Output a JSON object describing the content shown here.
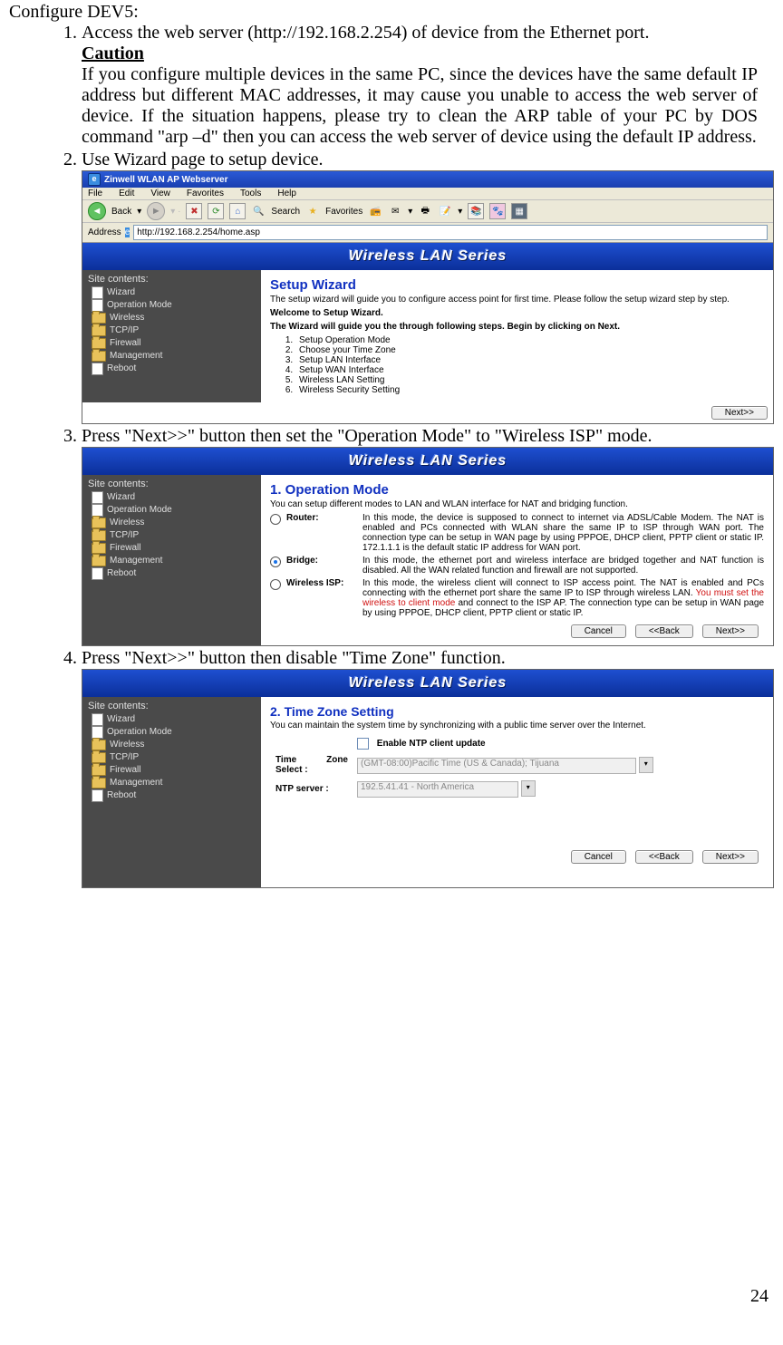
{
  "intro": "Configure DEV5:",
  "step1": "Access the web server (http://192.168.2.254) of device from the Ethernet port.",
  "caution_title": "Caution",
  "caution_body": "If you configure multiple devices in the same PC, since the devices have the same default IP address but different MAC addresses, it may cause you unable to access the web server of device. If the situation happens, please try to clean the ARP table of your PC by DOS command \"arp –d\" then you can access the web server of device using the default IP address.",
  "step2": "Use Wizard page to setup device.",
  "step3": "Press \"Next>>\" button then set the  \"Operation Mode\" to \"Wireless ISP\" mode.",
  "step4": "Press \"Next>>\" button then disable \"Time Zone\" function.",
  "page_number": "24",
  "ie": {
    "title": "Zinwell WLAN AP Webserver",
    "menu": {
      "file": "File",
      "edit": "Edit",
      "view": "View",
      "favorites": "Favorites",
      "tools": "Tools",
      "help": "Help"
    },
    "toolbar": {
      "back": "Back",
      "search": "Search",
      "favorites": "Favorites"
    },
    "address_label": "Address",
    "address_value": "http://192.168.2.254/home.asp"
  },
  "banner": "Wireless LAN Series",
  "sidebar": {
    "title": "Site contents:",
    "items": [
      {
        "icon": "doc",
        "label": "Wizard"
      },
      {
        "icon": "doc",
        "label": "Operation Mode"
      },
      {
        "icon": "folder",
        "label": "Wireless"
      },
      {
        "icon": "folder",
        "label": "TCP/IP"
      },
      {
        "icon": "folder",
        "label": "Firewall"
      },
      {
        "icon": "folder",
        "label": "Management"
      },
      {
        "icon": "doc",
        "label": "Reboot"
      }
    ]
  },
  "wizard1": {
    "title": "Setup Wizard",
    "desc": "The setup wizard will guide you to configure access point for first time. Please follow the setup wizard step by step.",
    "welcome": "Welcome to Setup Wizard.",
    "lead": "The Wizard will guide you the through following steps. Begin by clicking on Next.",
    "steps": [
      "Setup Operation Mode",
      "Choose your Time Zone",
      "Setup LAN Interface",
      "Setup WAN Interface",
      "Wireless LAN Setting",
      "Wireless Security Setting"
    ]
  },
  "wizard2": {
    "title": "1. Operation Mode",
    "desc": "You can setup different modes to LAN and WLAN interface for NAT and bridging function.",
    "modes": {
      "router": {
        "label": "Router:",
        "text": "In this mode, the device is supposed to connect to internet via ADSL/Cable Modem. The NAT is enabled and PCs connected with WLAN share the same IP to ISP through WAN port. The connection type can be setup in WAN page by using PPPOE, DHCP client, PPTP client or static IP. 172.1.1.1 is the default static IP address for WAN port."
      },
      "bridge": {
        "label": "Bridge:",
        "text": "In this mode, the ethernet port and wireless interface are bridged together and NAT function is disabled. All the WAN related function and firewall are not supported."
      },
      "wisp": {
        "label": "Wireless ISP:",
        "text_a": "In this mode, the wireless client will connect to ISP access point. The NAT is enabled and PCs connecting with the ethernet port share the same IP to ISP through wireless LAN. ",
        "text_red": "You must set the wireless to client mode",
        "text_b": " and connect to the ISP AP. The connection type can be setup in WAN page by using PPPOE, DHCP client, PPTP client or static IP."
      }
    }
  },
  "wizard3": {
    "title": "2. Time Zone Setting",
    "desc": "You can maintain the system time by synchronizing with a public time server over the Internet.",
    "enable_label": "Enable NTP client update",
    "tz_label": "Time Zone Select :",
    "tz_value": "(GMT-08:00)Pacific Time (US & Canada); Tijuana",
    "ntp_label": "NTP server :",
    "ntp_value": "192.5.41.41 - North America"
  },
  "buttons": {
    "cancel": "Cancel",
    "back": "<<Back",
    "next": "Next>>"
  }
}
